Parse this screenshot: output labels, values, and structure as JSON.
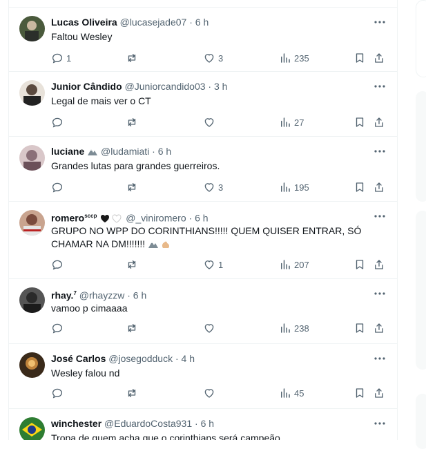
{
  "tweets": [
    {
      "name": "Lucas Oliveira",
      "handle": "@lucasejade07",
      "time": "6 h",
      "text": "Faltou Wesley",
      "replies": "1",
      "retweets": "",
      "likes": "3",
      "views": "235",
      "avatar_color": "#4a5a3c"
    },
    {
      "name": "Junior Cândido",
      "handle": "@Juniorcandido03",
      "time": "3 h",
      "text": "Legal de mais ver o CT",
      "replies": "",
      "retweets": "",
      "likes": "",
      "views": "27",
      "avatar_color": "#5b4a3f"
    },
    {
      "name": "luciane",
      "handle": "@ludamiati",
      "time": "6 h",
      "text": "Grandes lutas para grandes guerreiros.",
      "replies": "",
      "retweets": "",
      "likes": "3",
      "views": "195",
      "avatar_color": "#8a6f78"
    },
    {
      "name": "romero",
      "name_sup": "sccp",
      "handle": "@_viniromero",
      "time": "6 h",
      "text": "GRUPO NO WPP DO CORINTHIANS!!!!! QUEM QUISER ENTRAR, SÓ CHAMAR NA DM!!!!!!!",
      "replies": "",
      "retweets": "",
      "likes": "1",
      "views": "207",
      "avatar_color": "#7a4b3d"
    },
    {
      "name": "rhay.",
      "name_sup": "7",
      "handle": "@rhayzzw",
      "time": "6 h",
      "text": "vamoo p cimaaaa",
      "replies": "",
      "retweets": "",
      "likes": "",
      "views": "238",
      "avatar_color": "#3b3b3b"
    },
    {
      "name": "José Carlos",
      "handle": "@josegodduck",
      "time": "4 h",
      "text": "Wesley falou nd",
      "replies": "",
      "retweets": "",
      "likes": "",
      "views": "45",
      "avatar_color": "#6b4a2a"
    },
    {
      "name": "winchester",
      "handle": "@EduardoCosta931",
      "time": "6 h",
      "text": "Tropa de quem acha que o corinthians será campeão",
      "replies": "",
      "retweets": "",
      "likes": "",
      "views": "",
      "avatar_color": "#2e7d32"
    }
  ],
  "separator": "·",
  "colors": {
    "text": "#0f1419",
    "secondary": "#536471",
    "border": "#eff3f4"
  }
}
